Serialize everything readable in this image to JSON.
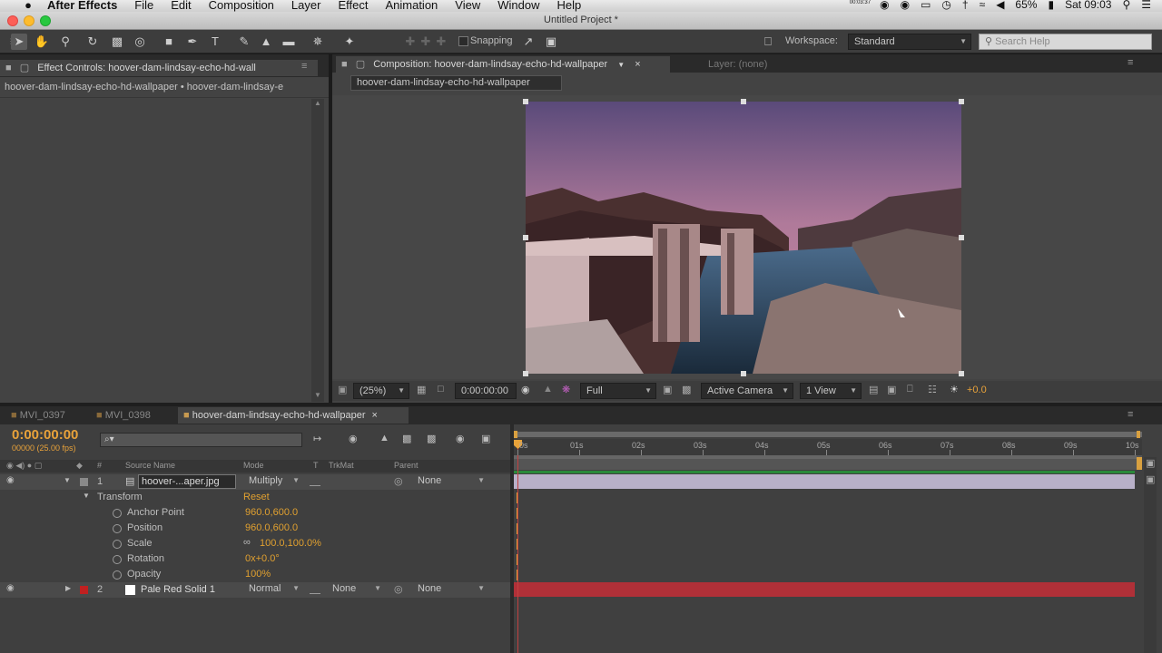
{
  "menubar": {
    "app_name": "After Effects",
    "items": [
      "File",
      "Edit",
      "Composition",
      "Layer",
      "Effect",
      "Animation",
      "View",
      "Window",
      "Help"
    ],
    "recording_line1": "00:03:37",
    "battery": "65%",
    "clock": "Sat 09:03"
  },
  "window": {
    "title": "Untitled Project *"
  },
  "toolbar": {
    "snapping_label": "Snapping",
    "workspace_label": "Workspace:",
    "workspace_value": "Standard",
    "search_placeholder": "Search Help"
  },
  "effect_controls": {
    "tab_label": "Effect Controls: hoover-dam-lindsay-echo-hd-wall",
    "breadcrumb": "hoover-dam-lindsay-echo-hd-wallpaper • hoover-dam-lindsay-e"
  },
  "composition": {
    "tab_label": "Composition: hoover-dam-lindsay-echo-hd-wallpaper",
    "layer_tab_label": "Layer: (none)",
    "subtab_label": "hoover-dam-lindsay-echo-hd-wallpaper",
    "zoom": "(25%)",
    "timecode": "0:00:00:00",
    "resolution": "Full",
    "camera": "Active Camera",
    "views": "1 View",
    "exposure": "+0.0"
  },
  "timeline": {
    "tabs": [
      "MVI_0397",
      "MVI_0398",
      "hoover-dam-lindsay-echo-hd-wallpaper"
    ],
    "timecode": "0:00:00:00",
    "frames": "00000 (25.00 fps)",
    "search_placeholder": "⌕▾",
    "ruler_labels": [
      "0s",
      "01s",
      "02s",
      "03s",
      "04s",
      "05s",
      "06s",
      "07s",
      "08s",
      "09s",
      "10s"
    ],
    "col_headers": {
      "num": "#",
      "source": "Source Name",
      "mode": "Mode",
      "t": "T",
      "trkmat": "TrkMat",
      "parent": "Parent"
    },
    "layers": [
      {
        "num": "1",
        "name": "hoover-...aper.jpg",
        "mode": "Multiply",
        "trkmat": "",
        "parent": "None",
        "label_color": "#8a8a8a",
        "bar_color": "#b8b0c8"
      },
      {
        "num": "2",
        "name": "Pale Red Solid 1",
        "mode": "Normal",
        "trkmat": "None",
        "parent": "None",
        "label_color": "#c02020",
        "bar_color": "#b03038"
      }
    ],
    "transform": {
      "label": "Transform",
      "reset": "Reset",
      "props": [
        {
          "name": "Anchor Point",
          "value": "960.0,600.0"
        },
        {
          "name": "Position",
          "value": "960.0,600.0"
        },
        {
          "name": "Scale",
          "value": "100.0,100.0%"
        },
        {
          "name": "Rotation",
          "value": "0x+0.0°"
        },
        {
          "name": "Opacity",
          "value": "100%"
        }
      ]
    }
  }
}
